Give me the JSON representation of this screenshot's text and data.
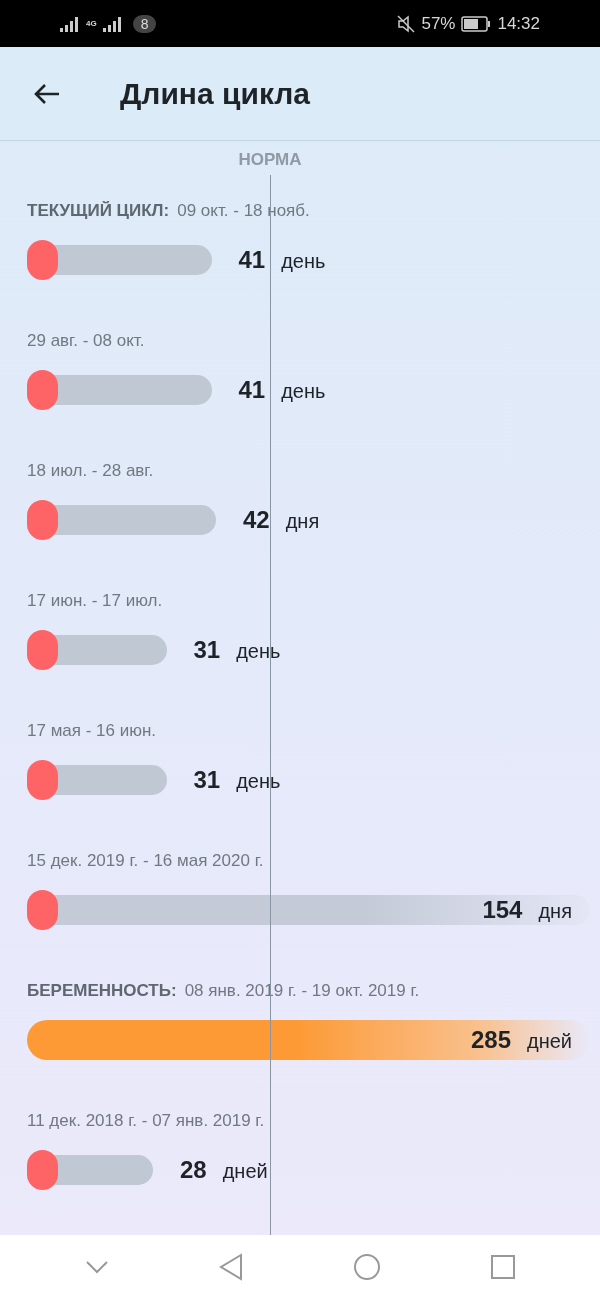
{
  "status_bar": {
    "network": "4G",
    "notifications": "8",
    "battery": "57%",
    "time": "14:32"
  },
  "header": {
    "title": "Длина цикла"
  },
  "norm_label": "НОРМА",
  "cycles": [
    {
      "kind": "cycle",
      "label": "ТЕКУЩИЙ ЦИКЛ:",
      "dates": "09 окт. - 18 нояб.",
      "days": "41",
      "unit": "день"
    },
    {
      "kind": "cycle",
      "dates": "29 авг. - 08 окт.",
      "days": "41",
      "unit": "день"
    },
    {
      "kind": "cycle",
      "dates": "18 июл. - 28 авг.",
      "days": "42",
      "unit": "дня"
    },
    {
      "kind": "cycle",
      "dates": "17 июн. - 17 июл.",
      "days": "31",
      "unit": "день"
    },
    {
      "kind": "cycle",
      "dates": "17 мая - 16 июн.",
      "days": "31",
      "unit": "день"
    },
    {
      "kind": "cycle",
      "dates": "15 дек. 2019 г. - 16 мая 2020 г.",
      "days": "154",
      "unit": "дня"
    },
    {
      "kind": "pregnancy",
      "label": "БЕРЕМЕННОСТЬ:",
      "dates": "08 янв. 2019 г. - 19 окт. 2019 г.",
      "days": "285",
      "unit": "дней"
    },
    {
      "kind": "cycle",
      "dates": "11 дек. 2018 г. - 07 янв. 2019 г.",
      "days": "28",
      "unit": "дней"
    }
  ]
}
